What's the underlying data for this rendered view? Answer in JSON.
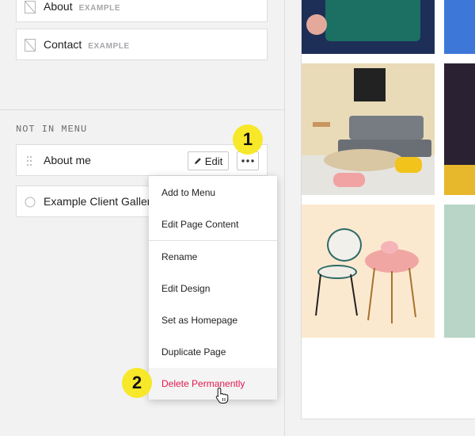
{
  "menu_pages": [
    {
      "label": "About",
      "tag": "EXAMPLE"
    },
    {
      "label": "Contact",
      "tag": "EXAMPLE"
    }
  ],
  "not_in_menu": {
    "section_label": "NOT IN MENU",
    "items": [
      {
        "label": "About me",
        "edit_label": "Edit"
      },
      {
        "label": "Example Client Gallery"
      }
    ]
  },
  "context_menu": {
    "items": [
      "Add to Menu",
      "Edit Page Content",
      "Rename",
      "Edit Design",
      "Set as Homepage",
      "Duplicate Page",
      "Delete Permanently"
    ]
  },
  "callouts": [
    "1",
    "2"
  ],
  "colors": {
    "accent_callout": "#f7e829",
    "danger": "#e0194f"
  }
}
